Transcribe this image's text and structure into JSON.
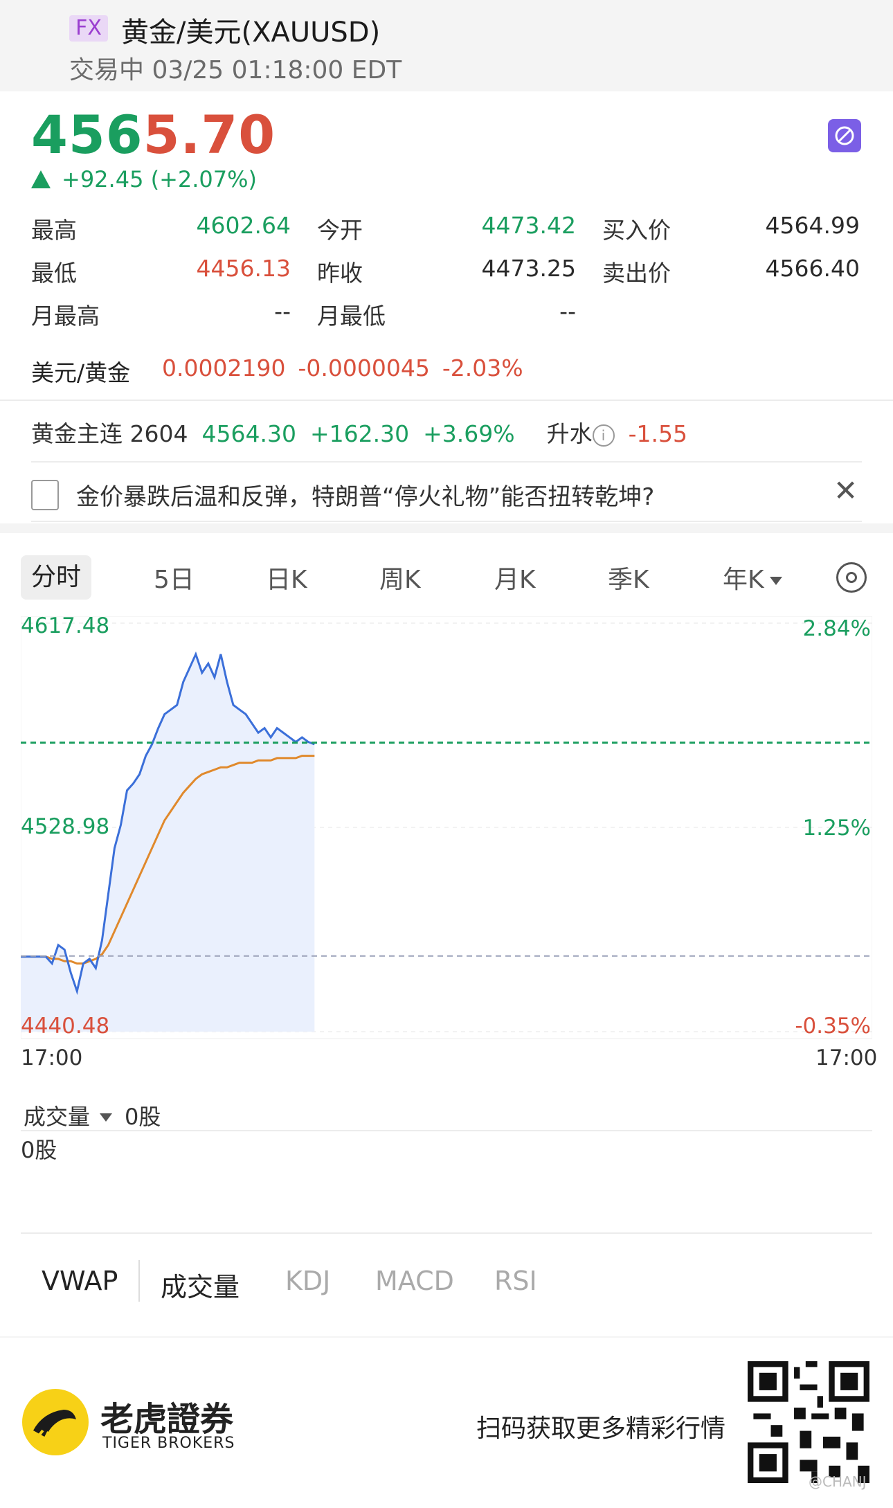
{
  "header": {
    "badge": "FX",
    "title": "黄金/美元(XAUUSD)",
    "subtitle": "交易中 03/25 01:18:00 EDT"
  },
  "quote": {
    "price_green_part": "456",
    "price_red_part": "5.70",
    "change": "+92.45 (+2.07%)",
    "stats": {
      "high_label": "最高",
      "high": "4602.64",
      "low_label": "最低",
      "low": "4456.13",
      "month_high_label": "月最高",
      "month_high": "--",
      "open_label": "今开",
      "open": "4473.42",
      "prev_close_label": "昨收",
      "prev_close": "4473.25",
      "month_low_label": "月最低",
      "month_low": "--",
      "bid_label": "买入价",
      "bid": "4564.99",
      "ask_label": "卖出价",
      "ask": "4566.40"
    },
    "fx_pair": {
      "label": "美元/黄金",
      "value": "0.0002190",
      "change": "-0.0000045",
      "percent": "-2.03%"
    },
    "futures": {
      "label": "黄金主连 2604",
      "price": "4564.30",
      "change": "+162.30",
      "percent": "+3.69%",
      "premium_label": "升水",
      "premium": "-1.55"
    },
    "news": {
      "headline": "金价暴跌后温和反弹，特朗普“停火礼物”能否扭转乾坤?"
    }
  },
  "chart_tabs": [
    "分时",
    "5日",
    "日K",
    "周K",
    "月K",
    "季K",
    "年K"
  ],
  "chart_data": {
    "type": "line",
    "y_left_ticks": [
      "4617.48",
      "4528.98",
      "4440.48"
    ],
    "y_right_ticks": [
      "2.84%",
      "1.25%",
      "-0.35%"
    ],
    "x_ticks": [
      "17:00",
      "17:00"
    ],
    "ylim": [
      4440.48,
      4617.48
    ],
    "prev_close": 4473.25,
    "current": 4565.7,
    "series": [
      {
        "color": "#3b6fd9",
        "values": [
          4473,
          4473,
          4473,
          4473,
          4473,
          4470,
          4478,
          4476,
          4466,
          4458,
          4470,
          4472,
          4468,
          4480,
          4500,
          4520,
          4530,
          4545,
          4548,
          4552,
          4560,
          4565,
          4572,
          4578,
          4580,
          4582,
          4592,
          4598,
          4604,
          4596,
          4600,
          4594,
          4604,
          4592,
          4582,
          4580,
          4578,
          4574,
          4570,
          4572,
          4568,
          4572,
          4570,
          4568,
          4566,
          4568,
          4566,
          4565
        ]
      },
      {
        "color": "#e0892c",
        "values": [
          4473,
          4473,
          4473,
          4473,
          4473,
          4472,
          4472,
          4471,
          4471,
          4470,
          4470,
          4471,
          4472,
          4474,
          4478,
          4484,
          4490,
          4496,
          4502,
          4508,
          4514,
          4520,
          4526,
          4532,
          4536,
          4540,
          4544,
          4547,
          4550,
          4552,
          4553,
          4554,
          4555,
          4555,
          4556,
          4557,
          4557,
          4557,
          4558,
          4558,
          4558,
          4559,
          4559,
          4559,
          4559,
          4560,
          4560,
          4560
        ]
      }
    ],
    "x_range_fraction_used": 0.345
  },
  "volume": {
    "label": "成交量",
    "value": "0股",
    "axis_value": "0股"
  },
  "indicator_tabs": [
    "VWAP",
    "成交量",
    "KDJ",
    "MACD",
    "RSI"
  ],
  "footer": {
    "logo_cn": "老虎證券",
    "logo_en": "TIGER BROKERS",
    "promo": "扫码获取更多精彩行情",
    "watermark": "@CHANJ"
  }
}
